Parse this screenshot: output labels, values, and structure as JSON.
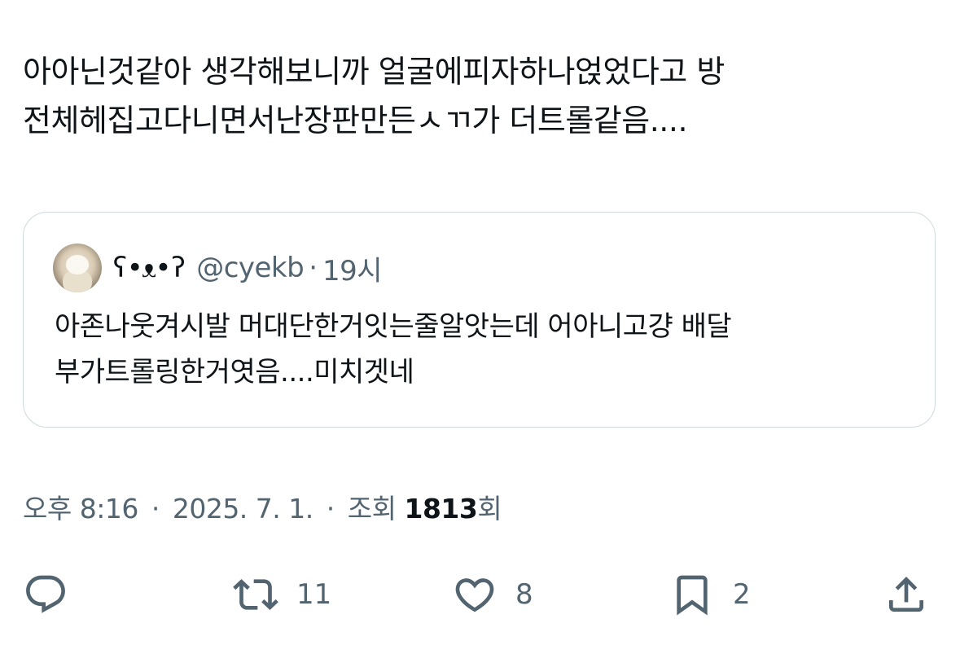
{
  "tweet": {
    "text": "아아닌것같아 생각해보니까 얼굴에피자하나얹었다고 방\n전체헤집고다니면서난장판만든ㅅㄲ가 더트롤같음...."
  },
  "quote": {
    "display_name": "ʕ•ᴥ•ʔ",
    "handle": "@cyekb",
    "separator": "·",
    "time": "19시",
    "text": "아존나웃겨시발 머대단한거잇는줄알앗는데 어아니고걍 배달\n부가트롤링한거엿음....미치겟네"
  },
  "meta": {
    "time": "오후 8:16",
    "separator": "·",
    "date": "2025. 7. 1.",
    "views_prefix": "조회",
    "views_count": "1813",
    "views_suffix": "회"
  },
  "actions": {
    "reply": {
      "icon": "reply-icon",
      "count": ""
    },
    "retweet": {
      "icon": "retweet-icon",
      "count": "11"
    },
    "like": {
      "icon": "heart-icon",
      "count": "8"
    },
    "bookmark": {
      "icon": "bookmark-icon",
      "count": "2"
    },
    "share": {
      "icon": "share-icon",
      "count": ""
    }
  },
  "colors": {
    "text_primary": "#0f1419",
    "text_secondary": "#536471",
    "border": "#cfd9de"
  }
}
